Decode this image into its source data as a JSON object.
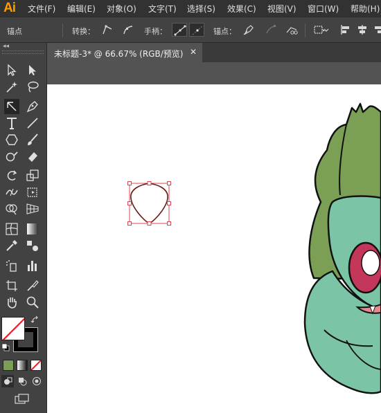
{
  "app": {
    "logo": "Ai"
  },
  "menu": [
    {
      "label": "文件(F)"
    },
    {
      "label": "编辑(E)"
    },
    {
      "label": "对象(O)"
    },
    {
      "label": "文字(T)"
    },
    {
      "label": "选择(S)"
    },
    {
      "label": "效果(C)"
    },
    {
      "label": "视图(V)"
    },
    {
      "label": "窗口(W)"
    },
    {
      "label": "帮助(H)"
    }
  ],
  "control_bar": {
    "selection_label": "锚点",
    "convert_label": "转换：",
    "handles_label": "手柄：",
    "anchor_label": "锚点："
  },
  "toolbox": {
    "collapse_glyph": "◂◂"
  },
  "document": {
    "tab_title": "未标题-3* @ 66.67% (RGB/预览)",
    "close_glyph": "✕",
    "zoom_percent": 66.67,
    "color_mode": "RGB"
  },
  "colors": {
    "accent_logo": "#ff9a00",
    "selection": "#d9444e",
    "bulb_green": "#7a9f55",
    "body_teal": "#7cc4a6",
    "eye_red": "#c2375a",
    "mouth_pink": "#e8868c"
  }
}
